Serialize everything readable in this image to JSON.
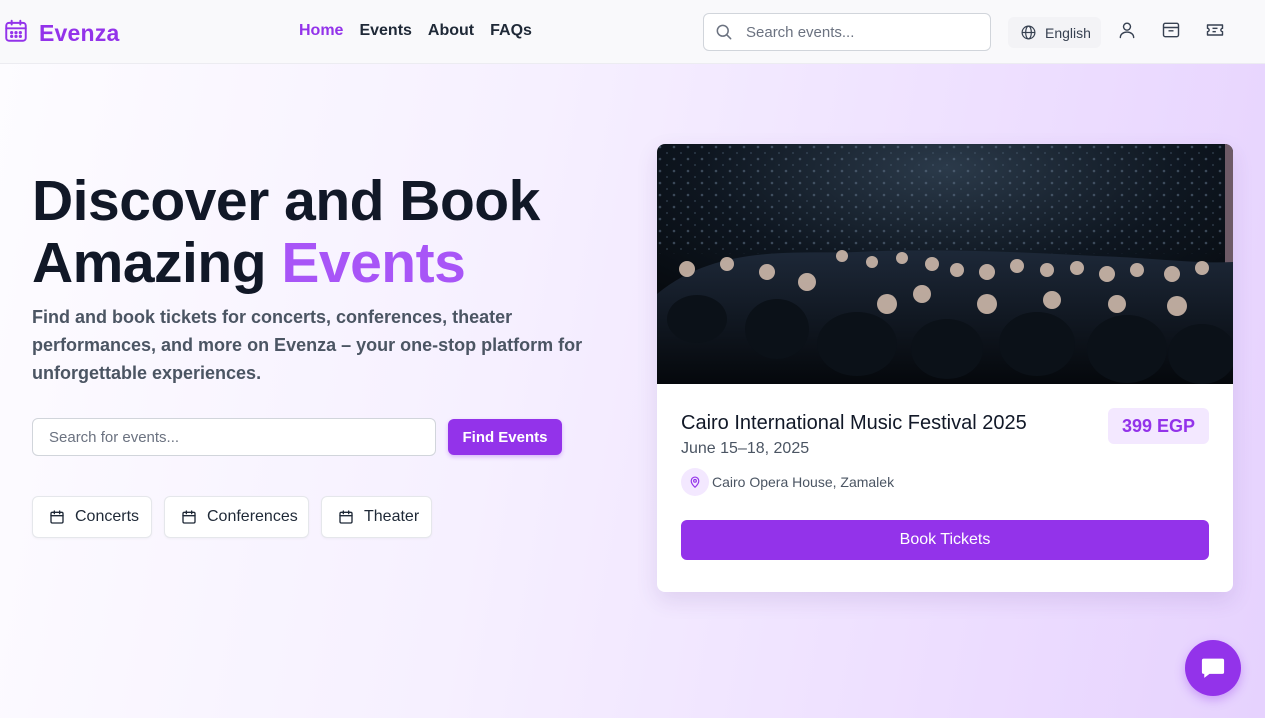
{
  "brand": {
    "name": "Evenza",
    "color": "#9333ea"
  },
  "nav": {
    "items": [
      {
        "label": "Home",
        "active": true
      },
      {
        "label": "Events",
        "active": false
      },
      {
        "label": "About",
        "active": false
      },
      {
        "label": "FAQs",
        "active": false
      }
    ]
  },
  "header": {
    "search_placeholder": "Search events...",
    "language": "English",
    "icons": [
      "user-icon",
      "inbox-icon",
      "ticket-icon"
    ]
  },
  "hero": {
    "title_line1": "Discover and Book",
    "title_line2_plain": "Amazing",
    "title_line2_accent": "Events",
    "subtitle": "Find and book tickets for concerts, conferences, theater performances, and more on Evenza – your one-stop platform for unforgettable experiences.",
    "search_placeholder": "Search for events...",
    "find_button": "Find Events",
    "categories": [
      {
        "label": "Concerts",
        "icon": "calendar-icon"
      },
      {
        "label": "Conferences",
        "icon": "calendar-icon"
      },
      {
        "label": "Theater",
        "icon": "calendar-icon"
      }
    ]
  },
  "featured_event": {
    "title": "Cairo International Music Festival 2025",
    "date": "June 15–18, 2025",
    "price": "399 EGP",
    "location": "Cairo Opera House, Zamalek",
    "book_button": "Book Tickets"
  },
  "chat": {
    "icon": "chat-bubble-icon"
  }
}
